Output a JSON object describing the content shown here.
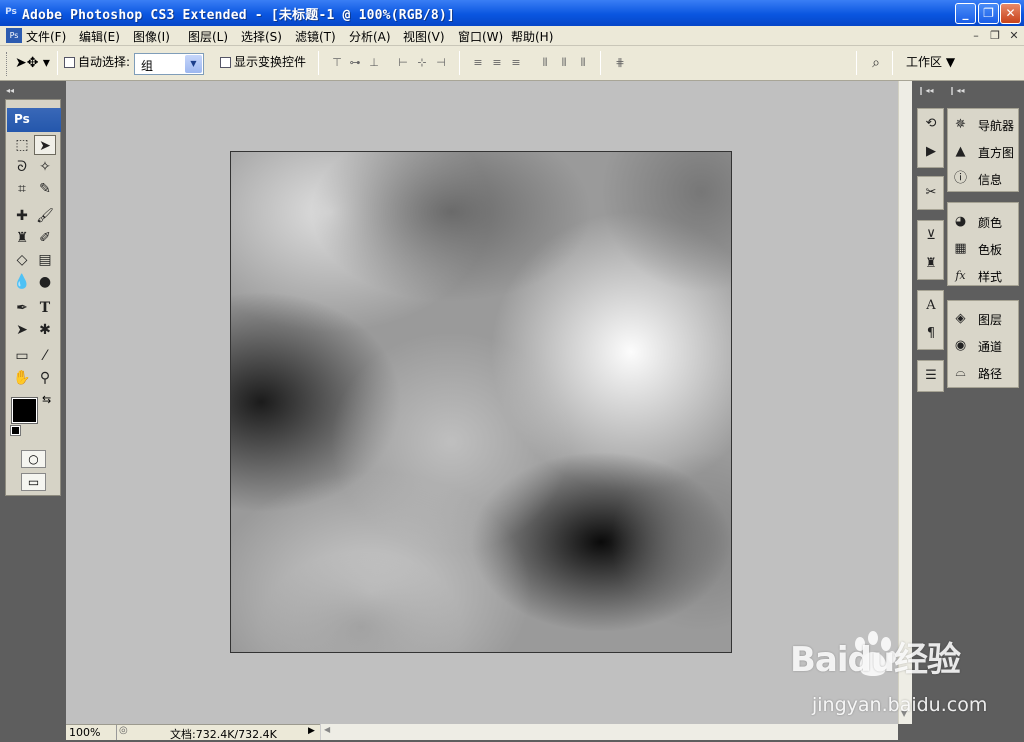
{
  "titlebar": {
    "title": "Adobe Photoshop CS3 Extended - [未标题-1 @ 100%(RGB/8)]",
    "app_icon": "Ps"
  },
  "menubar": {
    "items": [
      "文件(F)",
      "编辑(E)",
      "图像(I)",
      "图层(L)",
      "选择(S)",
      "滤镜(T)",
      "分析(A)",
      "视图(V)",
      "窗口(W)",
      "帮助(H)"
    ]
  },
  "options": {
    "auto_select_label": "自动选择:",
    "auto_select_checked": false,
    "auto_select_value": "组",
    "show_transform_label": "显示变换控件",
    "show_transform_checked": false,
    "workspace_label": "工作区 ▼"
  },
  "toolbox": {
    "header": "Ps"
  },
  "panels": {
    "group1": [
      "导航器",
      "直方图",
      "信息"
    ],
    "group2": [
      "颜色",
      "色板",
      "样式"
    ],
    "group3": [
      "图层",
      "通道",
      "路径"
    ]
  },
  "statusbar": {
    "zoom": "100%",
    "doc_info": "文档:732.4K/732.4K"
  },
  "watermark": {
    "text": "Baidu经验",
    "url": "jingyan.baidu.com"
  },
  "colors": {
    "foreground": "#000000",
    "background": "#ffffff",
    "titlebar": "#0a56e0"
  }
}
